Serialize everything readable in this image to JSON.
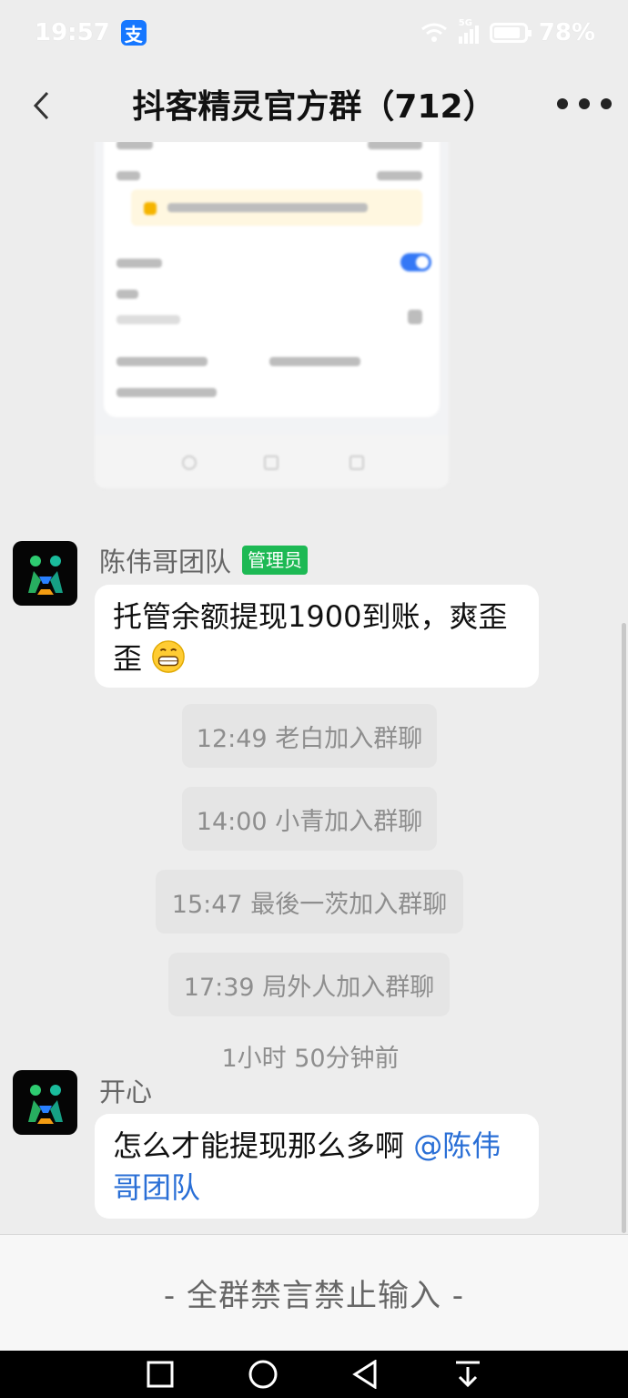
{
  "status_bar": {
    "time": "19:57",
    "app_icon": "alipay-icon",
    "app_icon_glyph": "支",
    "network_label": "5G",
    "battery_text": "78%"
  },
  "header": {
    "title": "抖客精灵官方群（712）",
    "back_icon": "chevron-left-icon",
    "more_icon": "more-dots-icon"
  },
  "messages": [
    {
      "sender": "陈伟哥团队",
      "badge": "管理员",
      "text_line": "托管余额提现1900到账，爽歪歪",
      "emoji": "grinning-face-emoji"
    },
    {
      "sender": "开心",
      "text": "怎么才能提现那么多啊 ",
      "mention": "@陈伟哥团队"
    }
  ],
  "system_messages": [
    "12:49 老白加入群聊",
    "14:00 小青加入群聊",
    "15:47 最後一茨加入群聊",
    "17:39 局外人加入群聊"
  ],
  "time_divider": "1小时 50分钟前",
  "mute_bar": {
    "text": "- 全群禁言禁止输入 -"
  },
  "colors": {
    "background": "#ededed",
    "admin_badge": "#1db954",
    "mention": "#2a6fd6",
    "avatar_bg": "#050505"
  },
  "nav_bar": {
    "buttons": [
      "square-recents-icon",
      "circle-home-icon",
      "triangle-back-icon",
      "download-arrow-icon"
    ]
  }
}
